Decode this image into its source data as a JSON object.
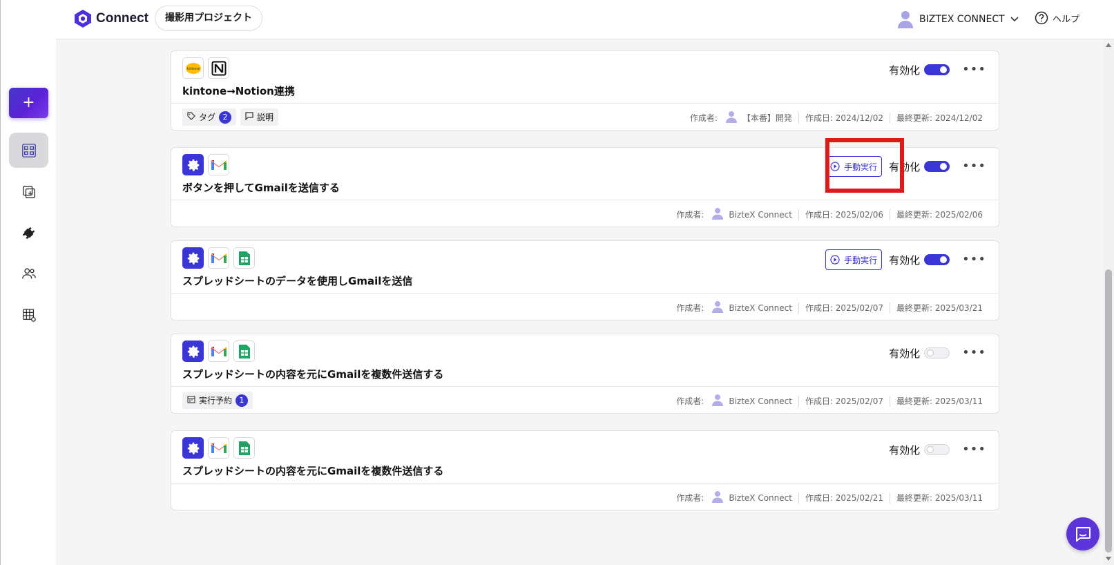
{
  "brand": {
    "name": "Connect"
  },
  "header": {
    "project": "撮影用プロジェクト",
    "user_name": "BIZTEX CONNECT",
    "help_label": "ヘルプ"
  },
  "sidebar": {
    "new_label": "+"
  },
  "common": {
    "enable_label": "有効化",
    "run_label": "手動実行",
    "creator_prefix": "作成者:",
    "more": "•••"
  },
  "flows": [
    {
      "title": "kintone→Notion連携",
      "icons": [
        "kintone-icon",
        "notion-icon"
      ],
      "enabled": true,
      "manual_run": false,
      "chips": [
        {
          "label": "タグ",
          "icon": "tag-icon",
          "count": "2"
        },
        {
          "label": "説明",
          "icon": "comment-icon",
          "count": ""
        }
      ],
      "creator": "【本番】開発",
      "created": "作成日: 2024/12/02",
      "updated": "最終更新: 2024/12/02"
    },
    {
      "title": "ボタンを押してGmailを送信する",
      "icons": [
        "gear-icon",
        "gmail-icon"
      ],
      "enabled": true,
      "manual_run": true,
      "chips": [],
      "creator": "BizteX Connect",
      "created": "作成日: 2025/02/06",
      "updated": "最終更新: 2025/02/06"
    },
    {
      "title": "スプレッドシートのデータを使用しGmailを送信",
      "icons": [
        "gear-icon",
        "gmail-icon",
        "sheets-icon"
      ],
      "enabled": true,
      "manual_run": true,
      "chips": [],
      "creator": "BizteX Connect",
      "created": "作成日: 2025/02/07",
      "updated": "最終更新: 2025/03/21"
    },
    {
      "title": "スプレッドシートの内容を元にGmailを複数件送信する",
      "icons": [
        "gear-icon",
        "gmail-icon",
        "sheets-icon"
      ],
      "enabled": false,
      "manual_run": false,
      "chips": [
        {
          "label": "実行予約",
          "icon": "calendar-icon",
          "count": "1"
        }
      ],
      "creator": "BizteX Connect",
      "created": "作成日: 2025/02/07",
      "updated": "最終更新: 2025/03/11"
    },
    {
      "title": "スプレッドシートの内容を元にGmailを複数件送信する",
      "icons": [
        "gear-icon",
        "gmail-icon",
        "sheets-icon"
      ],
      "enabled": false,
      "manual_run": false,
      "chips": [],
      "creator": "BizteX Connect",
      "created": "作成日: 2025/02/21",
      "updated": "最終更新: 2025/03/11"
    }
  ],
  "colors": {
    "accent": "#3a35d6",
    "highlight": "#e01818",
    "fab": "#5b35d8"
  }
}
